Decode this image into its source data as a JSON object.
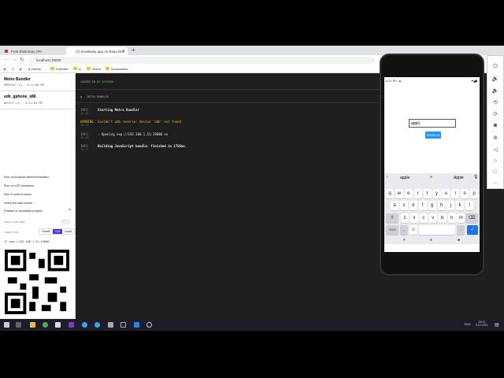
{
  "browser": {
    "tabs": [
      {
        "title": "Free Dictionary API",
        "active": false
      },
      {
        "title": "(7) knowlway app on Expo Dev",
        "active": true
      }
    ],
    "url": "localhost:19002",
    "bookmarks": [
      "GitHub",
      "Software",
      "tc",
      "others",
      "necessaries"
    ]
  },
  "sidebar": {
    "title": "Metro Bundler",
    "process": "PROCESS (1) - 6:11:00 PM",
    "device_name": "sdk_gphone_x86",
    "device": "DEVICE (3) - 6:11:04 PM",
    "actions": [
      "Run on Android device/emulator",
      "Run on iOS simulator",
      "Run in web browser",
      "Send link with email...",
      "Publish or republish project..."
    ],
    "production_mode_label": "PRODUCTION MODE",
    "connection_label": "CONNECTION",
    "connection_options": [
      "Tunnel",
      "LAN",
      "Local"
    ],
    "selected_connection": "LAN",
    "url": "exp://192.168.1.51:19000"
  },
  "terminal": {
    "logged_in_prefix": "LOGGED IN AS",
    "user": "AYDOGDU",
    "panel_title": "METRO BUNDLER",
    "logs": [
      {
        "level": "INFO",
        "time": "18:18",
        "message": "Starting Metro Bundler"
      },
      {
        "level": "WARNING",
        "time": "18:18",
        "message": "Couldn't adb reverse: device 'adb' not found"
      },
      {
        "level": "INFO",
        "time": "18:18",
        "message": "› Opening exp://192.168.1.51:19000 on"
      },
      {
        "level": "INFO",
        "time": "18:11",
        "message": "Building JavaScript bundle: finished in 1756ms."
      }
    ]
  },
  "phone": {
    "status_time": "6:11",
    "input_value": "appl",
    "search_label": "SEARCH",
    "suggestions": [
      "apple",
      "Apple"
    ],
    "rows": [
      [
        "q",
        "w",
        "e",
        "r",
        "t",
        "y",
        "u",
        "i",
        "o",
        "p"
      ],
      [
        "a",
        "s",
        "d",
        "f",
        "g",
        "h",
        "j",
        "k",
        "l"
      ],
      [
        "z",
        "x",
        "c",
        "v",
        "b",
        "n",
        "m"
      ]
    ],
    "symbols_key": "?123",
    "comma": ",",
    "period": "."
  },
  "taskbar": {
    "time": "18:11",
    "date": "5.12.2021",
    "lang": "ENG"
  },
  "colors": {
    "accent": "#2196f3",
    "lan": "#4630eb",
    "warning": "#e6c229",
    "user": "#4ec24e"
  }
}
